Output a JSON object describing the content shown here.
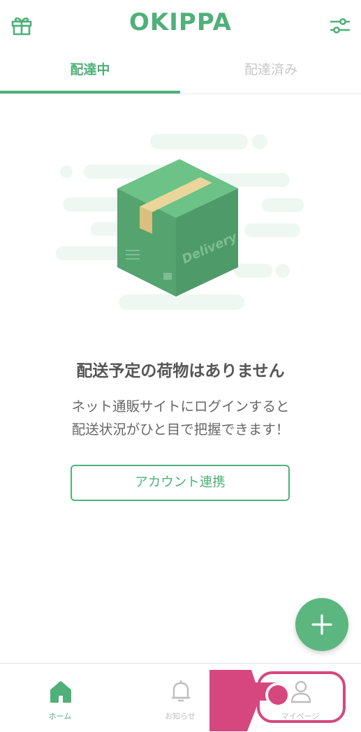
{
  "header": {
    "logo": "OKIPPA",
    "gift_icon": "gift-icon",
    "filter_icon": "filter-sliders-icon"
  },
  "tabs": [
    {
      "label": "配達中",
      "active": true
    },
    {
      "label": "配達済み",
      "active": false
    }
  ],
  "illustration": {
    "box_text": "Delivery"
  },
  "empty_state": {
    "title": "配送予定の荷物はありません",
    "description_line1": "ネット通販サイトにログインすると",
    "description_line2": "配送状況がひと目で把握できます！",
    "button_label": "アカウント連携"
  },
  "fab": {
    "icon": "plus-icon"
  },
  "bottom_nav": [
    {
      "label": "ホーム",
      "icon": "home-icon",
      "active": true
    },
    {
      "label": "お知らせ",
      "icon": "bell-icon",
      "active": false
    },
    {
      "label": "マイページ",
      "icon": "user-icon",
      "active": false
    }
  ],
  "colors": {
    "accent": "#4fb079",
    "highlight": "#d6477f",
    "inactive": "#c8c8c8"
  }
}
